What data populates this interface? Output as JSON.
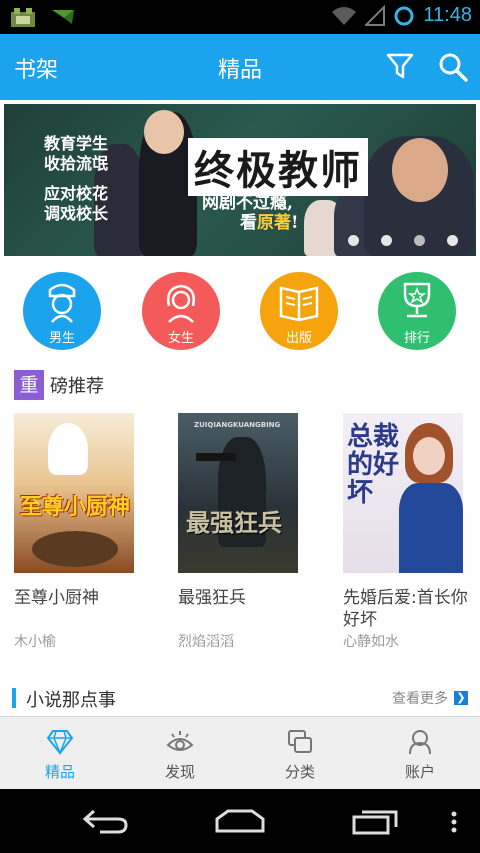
{
  "status_bar": {
    "time": "11:48"
  },
  "app_bar": {
    "shelf_label": "书架",
    "title": "精品"
  },
  "banner": {
    "left_text_1": "教育学生\n收拾流氓",
    "left_text_2": "应对校花\n调戏校长",
    "headline": "终极教师",
    "tagline_1": "网剧不过瘾,",
    "tagline_2a": "看",
    "tagline_2b": "原著",
    "tagline_2c": "!",
    "page_count": 4,
    "active_page": 3
  },
  "categories": [
    {
      "label": "男生",
      "color": "#1ba3ee",
      "icon": "male-icon"
    },
    {
      "label": "女生",
      "color": "#f55a5a",
      "icon": "female-icon"
    },
    {
      "label": "出版",
      "color": "#f5a40e",
      "icon": "book-icon"
    },
    {
      "label": "排行",
      "color": "#2fbf6f",
      "icon": "trophy-icon"
    }
  ],
  "featured_section": {
    "badge": "重",
    "title": "磅推荐"
  },
  "books": [
    {
      "title": "至尊小厨神",
      "author": "木小榆",
      "cover_text": "至尊小厨神"
    },
    {
      "title": "最强狂兵",
      "author": "烈焰滔滔",
      "cover_text": "最强狂兵",
      "cover_sub": "ZUIQIANGKUANGBING"
    },
    {
      "title": "先婚后爱:首长你好坏",
      "author": "心静如水",
      "cover_text": "总裁的好坏"
    }
  ],
  "novel_section": {
    "title": "小说那点事",
    "more_label": "查看更多"
  },
  "tabs": [
    {
      "label": "精品",
      "icon": "diamond-icon",
      "active": true
    },
    {
      "label": "发现",
      "icon": "eye-icon",
      "active": false
    },
    {
      "label": "分类",
      "icon": "category-icon",
      "active": false
    },
    {
      "label": "账户",
      "icon": "account-icon",
      "active": false
    }
  ],
  "colors": {
    "primary": "#1ba3ee",
    "tab_bar_bg": "#efefef"
  }
}
